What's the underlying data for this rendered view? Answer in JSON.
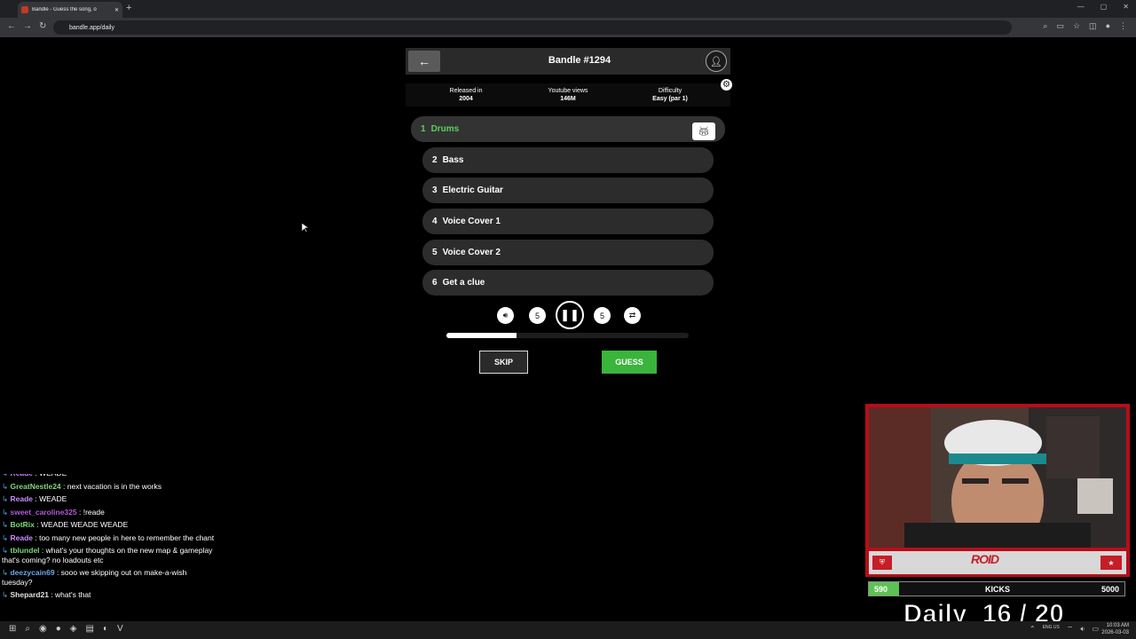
{
  "browser": {
    "tab_title": "Bandle - Guess the song, o",
    "new_tab": "+",
    "url": "bandle.app/daily",
    "window_buttons": [
      "—",
      "▢",
      "✕"
    ]
  },
  "game": {
    "title": "Bandle #1294",
    "info": [
      {
        "label": "Released in",
        "value": "2004"
      },
      {
        "label": "Youtube views",
        "value": "146M"
      },
      {
        "label": "Difficulty",
        "value": "Easy (par 1)"
      }
    ],
    "stems": [
      {
        "num": "1",
        "label": "Drums",
        "active": true
      },
      {
        "num": "2",
        "label": "Bass",
        "active": false
      },
      {
        "num": "3",
        "label": "Electric Guitar",
        "active": false
      },
      {
        "num": "4",
        "label": "Voice Cover 1",
        "active": false
      },
      {
        "num": "5",
        "label": "Voice Cover 2",
        "active": false
      },
      {
        "num": "6",
        "label": "Get a clue",
        "active": false
      }
    ],
    "controls": {
      "rewind": "5",
      "forward": "5"
    },
    "progress": 0.29,
    "skip_label": "SKIP",
    "guess_label": "GUESS"
  },
  "chat": [
    {
      "user": "Reade",
      "color": "#c88cff",
      "text": "WEADE"
    },
    {
      "user": "GreatNestle24",
      "color": "#7fd67f",
      "text": "next vacation is in the works"
    },
    {
      "user": "Reade",
      "color": "#c88cff",
      "text": "WEADE"
    },
    {
      "user": "sweet_caroline325",
      "color": "#b05ad8",
      "text": "!reade"
    },
    {
      "user": "BotRix",
      "color": "#7fd67f",
      "text": "WEADE WEADE WEADE"
    },
    {
      "user": "Reade",
      "color": "#c88cff",
      "text": "too many new people in here to remember the chant"
    },
    {
      "user": "tblundel",
      "color": "#7fd67f",
      "text": "what's your thoughts on the new map & gameplay that's coming? no loadouts etc"
    },
    {
      "user": "deezycain69",
      "color": "#6ea6e8",
      "text": "sooo we skipping out on make-a-wish tuesday?"
    },
    {
      "user": "Shepard21",
      "color": "#e0e0e0",
      "text": "what's that"
    }
  ],
  "overlay": {
    "logo": "ROID",
    "kicks_current": "590",
    "kicks_label": "KICKS",
    "kicks_max": "5000",
    "kicks_fraction": 0.118,
    "daily": "Daily  16 / 20"
  },
  "taskbar": {
    "time": "10:03 AM",
    "date": "2026-03-03",
    "lang": "ENG US"
  }
}
